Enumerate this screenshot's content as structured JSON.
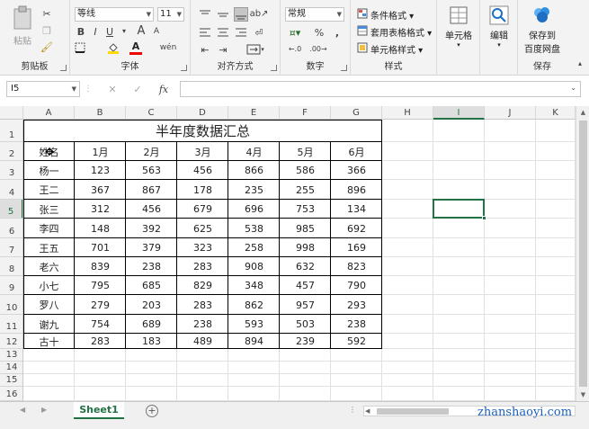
{
  "ribbon": {
    "clipboard": {
      "label": "剪贴板",
      "paste": "粘贴"
    },
    "font": {
      "label": "字体",
      "font_name": "等线",
      "font_size": "11",
      "bold": "B",
      "italic": "I",
      "underline": "U",
      "grow": "A",
      "shrink": "A",
      "wen": "wén"
    },
    "alignment": {
      "label": "对齐方式"
    },
    "number": {
      "label": "数字",
      "format": "常规",
      "percent": "%",
      "comma": ","
    },
    "styles": {
      "label": "样式",
      "conditional": "条件格式",
      "table": "套用表格格式",
      "cell_style": "单元格样式"
    },
    "cells": {
      "label": "单元格"
    },
    "editing": {
      "label": "编辑"
    },
    "save": {
      "label": "保存",
      "btn_line1": "保存到",
      "btn_line2": "百度网盘"
    }
  },
  "formula_bar": {
    "name_box": "I5",
    "fx": "fx",
    "value": ""
  },
  "columns": [
    "A",
    "B",
    "C",
    "D",
    "E",
    "F",
    "G",
    "H",
    "I",
    "J",
    "K"
  ],
  "active_column": "I",
  "rows": [
    "1",
    "2",
    "3",
    "4",
    "5",
    "6",
    "7",
    "8",
    "9",
    "10",
    "11",
    "12",
    "13",
    "14",
    "15",
    "16"
  ],
  "active_row": "5",
  "sheet": {
    "title": "半年度数据汇总",
    "headers": [
      "姓名",
      "1月",
      "2月",
      "3月",
      "4月",
      "5月",
      "6月"
    ],
    "data": [
      [
        "杨一",
        "123",
        "563",
        "456",
        "866",
        "586",
        "366"
      ],
      [
        "王二",
        "367",
        "867",
        "178",
        "235",
        "255",
        "896"
      ],
      [
        "张三",
        "312",
        "456",
        "679",
        "696",
        "753",
        "134"
      ],
      [
        "李四",
        "148",
        "392",
        "625",
        "538",
        "985",
        "692"
      ],
      [
        "王五",
        "701",
        "379",
        "323",
        "258",
        "998",
        "169"
      ],
      [
        "老六",
        "839",
        "238",
        "283",
        "908",
        "632",
        "823"
      ],
      [
        "小七",
        "795",
        "685",
        "829",
        "348",
        "457",
        "790"
      ],
      [
        "罗八",
        "279",
        "203",
        "283",
        "862",
        "957",
        "293"
      ],
      [
        "谢九",
        "754",
        "689",
        "238",
        "593",
        "503",
        "238"
      ],
      [
        "古十",
        "283",
        "183",
        "489",
        "894",
        "239",
        "592"
      ]
    ]
  },
  "tabs": {
    "sheet1": "Sheet1",
    "add": "+"
  },
  "watermark": "zhanshaoyi.com",
  "colors": {
    "accent": "#217346",
    "watermark": "#1a5fc0"
  }
}
